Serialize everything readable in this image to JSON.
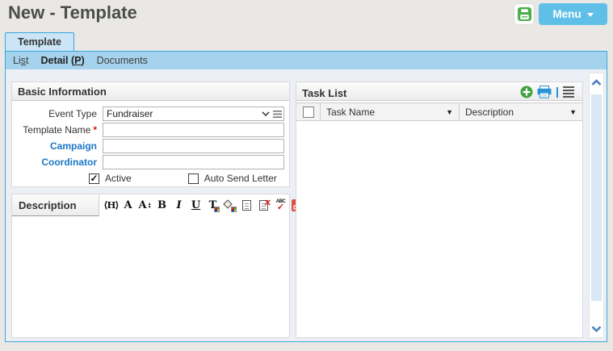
{
  "header": {
    "title": "New - Template",
    "menu_label": "Menu"
  },
  "tab": {
    "label": "Template"
  },
  "submenu": {
    "list": {
      "pre": "Li",
      "key": "s",
      "post": "t"
    },
    "detail": {
      "pre": "Detail (",
      "key": "P",
      "post": ")"
    },
    "documents": {
      "pre": "Documents",
      "key": "",
      "post": ""
    }
  },
  "basic_info": {
    "title": "Basic Information",
    "event_type": {
      "label": "Event Type",
      "value": "Fundraiser"
    },
    "template_name": {
      "label": "Template Name",
      "required_mark": "*",
      "value": ""
    },
    "campaign": {
      "label": "Campaign",
      "value": ""
    },
    "coordinator": {
      "label": "Coordinator",
      "value": ""
    },
    "active": {
      "label": "Active",
      "checked": true,
      "check_glyph": "✓"
    },
    "auto_send_letter": {
      "label": "Auto Send Letter",
      "checked": false
    }
  },
  "description": {
    "title": "Description",
    "body_text": "",
    "toolbar": [
      {
        "name": "heading-icon",
        "glyph": "⟨H⟩"
      },
      {
        "name": "font-name-icon",
        "glyph": "A"
      },
      {
        "name": "font-size-icon",
        "glyph": "A",
        "up": "▲",
        "down": "▼"
      },
      {
        "name": "bold-icon",
        "glyph": "B"
      },
      {
        "name": "italic-icon",
        "glyph": "I"
      },
      {
        "name": "underline-icon",
        "glyph": "U"
      },
      {
        "name": "text-color-icon",
        "glyph": "T"
      },
      {
        "name": "fill-color-icon",
        "glyph": ""
      },
      {
        "name": "paste-document-icon",
        "glyph": ""
      },
      {
        "name": "remove-format-icon",
        "glyph": "",
        "x": "✕"
      },
      {
        "name": "spell-check-icon",
        "glyph": "ABC",
        "check": "✓"
      },
      {
        "name": "expand-editor-icon",
        "glyph": ""
      }
    ]
  },
  "task_list": {
    "title": "Task List",
    "filter_glyph": "▼",
    "columns": [
      {
        "label": "Task Name"
      },
      {
        "label": "Description"
      }
    ],
    "rows": []
  },
  "colors": {
    "accent_blue": "#3aa7de",
    "submenu_blue": "#a5d2ec",
    "tab_blue": "#cbe5f6",
    "menu_button_blue": "#60bfe6",
    "link_blue": "#1a77c4",
    "save_green": "#4aae4a",
    "add_green": "#3fa33f",
    "printer_blue": "#2a93d5",
    "expand_red": "#dd5144",
    "required_red": "#e01010",
    "scrollbar_arrow_blue": "#4a7fc0"
  }
}
